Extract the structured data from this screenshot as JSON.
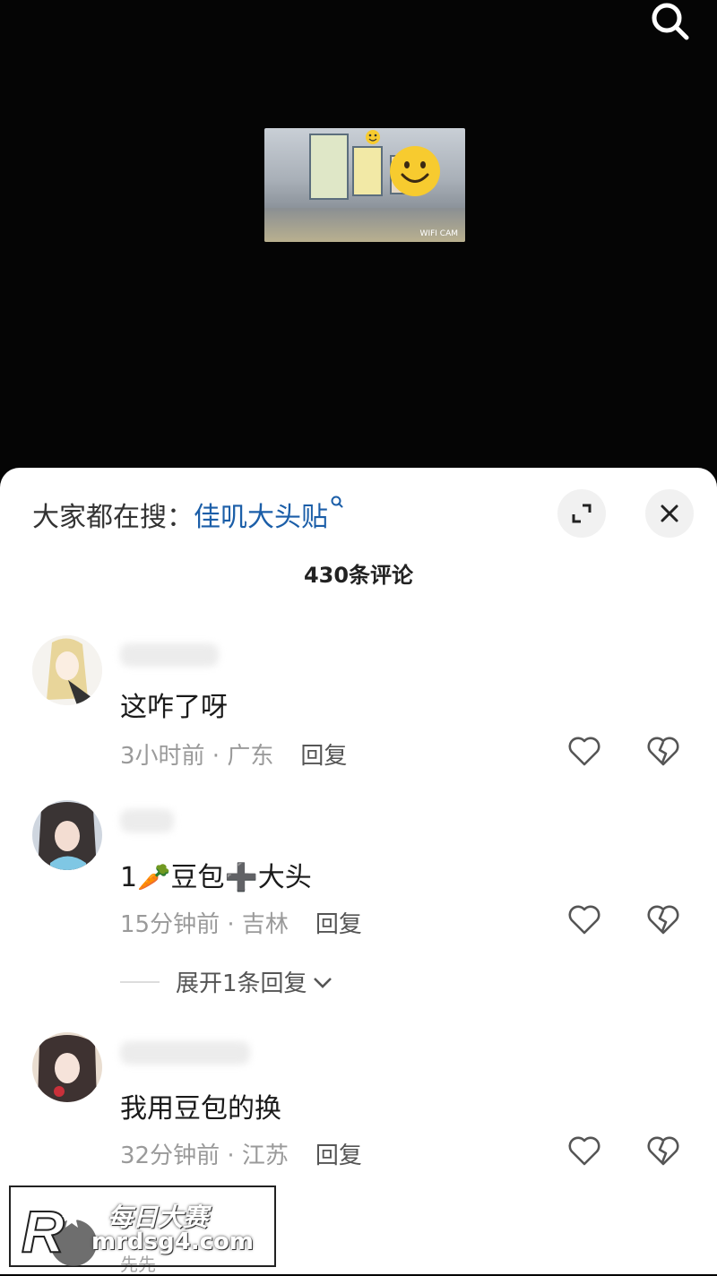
{
  "video": {
    "camera_overlay_text": "WIFI CAM"
  },
  "sheet": {
    "trending_label": "大家都在搜：",
    "trending_keyword": "佳叽大头贴",
    "comment_count_label": "430条评论"
  },
  "comments": [
    {
      "text": "这咋了呀",
      "time": "3小时前",
      "location": "广东",
      "reply_label": "回复"
    },
    {
      "text": "1🥕豆包➕大头",
      "time": "15分钟前",
      "location": "吉林",
      "reply_label": "回复",
      "expand_label": "展开1条回复"
    },
    {
      "text": "我用豆包的换",
      "time": "32分钟前",
      "location": "江苏",
      "reply_label": "回复"
    }
  ],
  "partial_comment_name": "先先",
  "watermark": {
    "title": "每日大赛",
    "url": "mrdsg4.com",
    "logo_letter": "R"
  },
  "colors": {
    "keyword": "#1b5ea8",
    "meta_gray": "#9a9a9a",
    "sheet_bg": "#ffffff"
  },
  "icons": {
    "search": "search-icon",
    "expand_fullscreen": "expand-icon",
    "close": "close-icon",
    "like": "heart-icon",
    "dislike": "broken-heart-icon"
  }
}
